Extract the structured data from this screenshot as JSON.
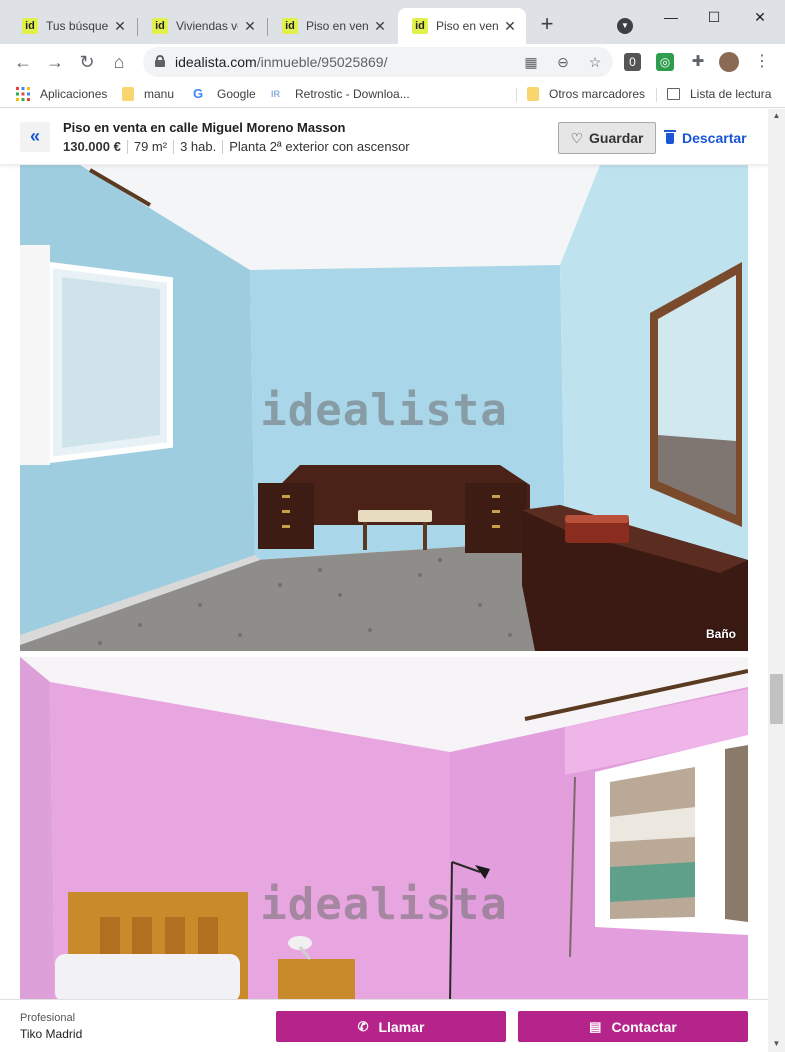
{
  "browser": {
    "tabs": [
      {
        "title": "Tus búsqued",
        "favicon": "id",
        "active": false
      },
      {
        "title": "Viviendas ve",
        "favicon": "id",
        "active": false
      },
      {
        "title": "Piso en vent",
        "favicon": "id",
        "active": false
      },
      {
        "title": "Piso en vent",
        "favicon": "id",
        "active": true
      }
    ],
    "new_tab": "+",
    "url_domain": "idealista.com",
    "url_path": "/inmueble/95025869/",
    "window_controls": {
      "minimize": "—",
      "maximize": "☐",
      "close": "✕"
    },
    "bookmarks": [
      {
        "label": "Aplicaciones",
        "icon": "apps-grid-icon"
      },
      {
        "label": "manu",
        "icon": "folder-icon"
      },
      {
        "label": "Google",
        "icon": "google-icon"
      },
      {
        "label": "Retrostic - Downloa...",
        "icon": "retrostic-icon"
      }
    ],
    "other_bookmarks": "Otros marcadores",
    "reading_list": "Lista de lectura"
  },
  "listing": {
    "back_icon": "«",
    "title": "Piso en venta en calle Miguel Moreno Masson",
    "price": "130.000 €",
    "area": "79 m²",
    "rooms": "3 hab.",
    "floor": "Planta 2ª exterior con ascensor",
    "save_label": "Guardar",
    "discard_label": "Descartar"
  },
  "photos": [
    {
      "watermark": "idealista",
      "caption": "Baño"
    },
    {
      "watermark": "idealista",
      "caption": ""
    }
  ],
  "contact": {
    "seller_type": "Profesional",
    "seller_name": "Tiko Madrid",
    "call_label": "Llamar",
    "contact_label": "Contactar"
  },
  "colors": {
    "brand_magenta": "#b5248a",
    "link_blue": "#1a55d6",
    "favicon_yellow": "#e1f04a"
  }
}
